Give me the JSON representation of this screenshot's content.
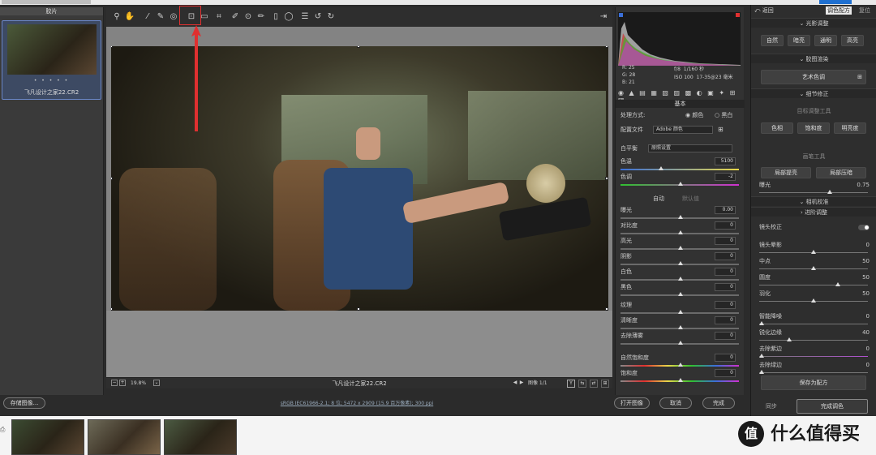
{
  "app": {
    "filmstrip_title": "胶片",
    "file_name": "飞凡设计之家22.CR2",
    "rating_dots": "• • • • •"
  },
  "canvas": {
    "zoom": "19.8%",
    "footer_name": "飞凡设计之家22.CR2",
    "image_counter": "图像 1/1"
  },
  "bottombar": {
    "save_label": "存储图像...",
    "info": "sRGB IEC61966-2.1; 8 位; 5472 x 2909 (15.9 百万像素); 300 ppi",
    "open_label": "打开图像",
    "cancel_label": "取消",
    "done_label": "完成"
  },
  "camera": {
    "r": "25",
    "g": "28",
    "b": "21",
    "aperture": "f/8",
    "shutter": "1/160 秒",
    "iso": "ISO 100",
    "lens": "17-35@23 毫米"
  },
  "basic": {
    "title": "基本",
    "process_label": "处理方式:",
    "process_color": "颜色",
    "process_bw": "黑白",
    "profile_label": "配置文件",
    "profile_value": "Adobe 颜色",
    "wb_label": "白平衡",
    "wb_value": "原照设置",
    "temp_label": "色温",
    "temp_value": "5100",
    "tint_label": "色调",
    "tint_value": "-2",
    "auto_label": "自动",
    "default_label": "默认值",
    "sliders": [
      {
        "label": "曝光",
        "value": "0.00"
      },
      {
        "label": "对比度",
        "value": "0"
      },
      {
        "label": "高光",
        "value": "0"
      },
      {
        "label": "阴影",
        "value": "0"
      },
      {
        "label": "白色",
        "value": "0"
      },
      {
        "label": "黑色",
        "value": "0"
      }
    ],
    "sliders2": [
      {
        "label": "纹理",
        "value": "0"
      },
      {
        "label": "清晰度",
        "value": "0"
      },
      {
        "label": "去除薄雾",
        "value": "0"
      }
    ],
    "sliders3": [
      {
        "label": "自然饱和度",
        "value": "0"
      },
      {
        "label": "饱和度",
        "value": "0"
      }
    ]
  },
  "right": {
    "back_label": "返回",
    "tab_color": "调色配方",
    "tab_reset": "复位",
    "section_light": "光影调整",
    "light_buttons": [
      "自然",
      "暗亮",
      "通明",
      "高亮"
    ],
    "section_art": "胶图渲染",
    "art_button": "艺术色调",
    "section_detail": "细节修正",
    "target_tool": "目标调整工具",
    "target_buttons": [
      "色相",
      "饱和度",
      "明亮度"
    ],
    "brush_tool": "画笔工具",
    "brush_buttons": [
      "局部提亮",
      "局部压暗"
    ],
    "exposure_label": "曝光",
    "exposure_value": "0.75",
    "section_camera": "相机校准",
    "section_advanced": "进阶调整",
    "lens_correction": "镜头校正",
    "adv_sliders": [
      {
        "label": "镜头晕影",
        "value": "0"
      },
      {
        "label": "中点",
        "value": "50"
      },
      {
        "label": "圆度",
        "value": "50"
      },
      {
        "label": "羽化",
        "value": "50"
      }
    ],
    "adv_sliders2": [
      {
        "label": "智能降噪",
        "value": "0"
      },
      {
        "label": "锐化边缘",
        "value": "40"
      },
      {
        "label": "去除紫边",
        "value": "0"
      },
      {
        "label": "去除绿边",
        "value": "0"
      }
    ],
    "save_preset": "保存为配方",
    "sync_label": "同步",
    "finish_label": "完成调色"
  },
  "watermark": {
    "logo_char": "值",
    "text": "什么值得买"
  },
  "colors": {
    "accent_red": "#e03030",
    "selection_blue": "#6a86c7"
  }
}
